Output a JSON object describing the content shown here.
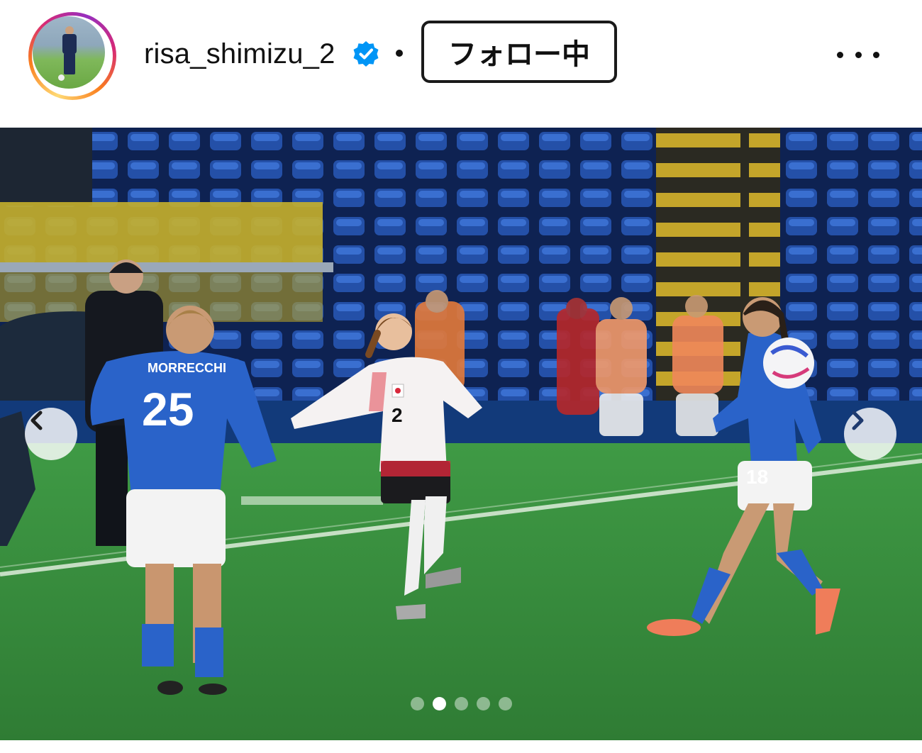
{
  "header": {
    "username": "risa_shimizu_2",
    "separator": "•",
    "follow_label": "フォロー中",
    "more_icon": "more-horizontal-icon",
    "verified_icon": "verified-badge-icon"
  },
  "post": {
    "carousel_total": 5,
    "carousel_active_index": 2,
    "prev_icon": "chevron-left-icon",
    "next_icon": "chevron-right-icon",
    "jersey_left_name": "MORRECCHI",
    "jersey_left_number": "25",
    "jersey_center_number": "2",
    "jersey_right_number": "18"
  },
  "colors": {
    "verified_blue": "#0095f6",
    "stadium_seat_blue": "#1f4fa6",
    "pitch_green": "#3a8f3f",
    "italy_blue": "#2a63c9"
  }
}
